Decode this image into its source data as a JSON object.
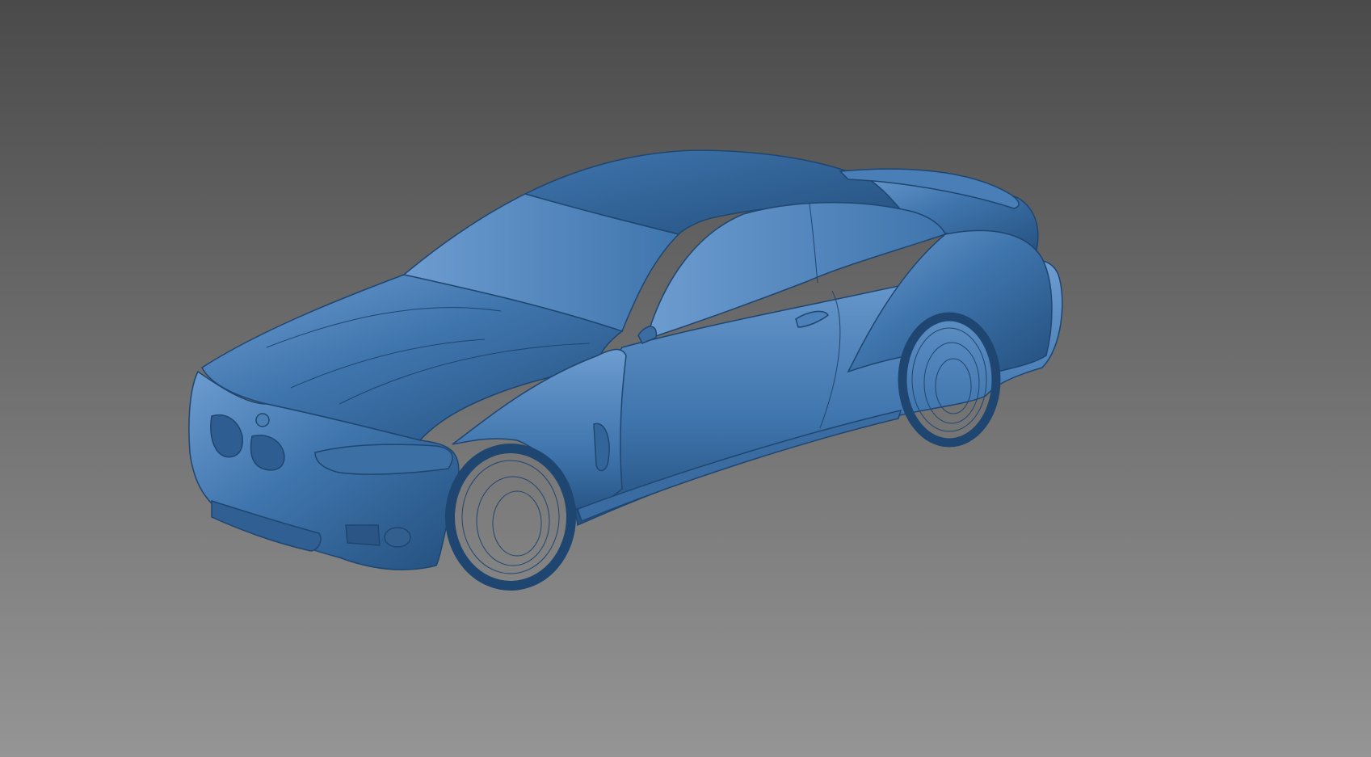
{
  "viewport": {
    "background_top": "#4a4a4a",
    "background_bottom": "#959595",
    "model_color": "#3f75ad",
    "model_highlight": "#6d9cd0",
    "model_shadow": "#24507f",
    "edge_color": "#1f4670",
    "model_icon": "car-model-icon"
  }
}
